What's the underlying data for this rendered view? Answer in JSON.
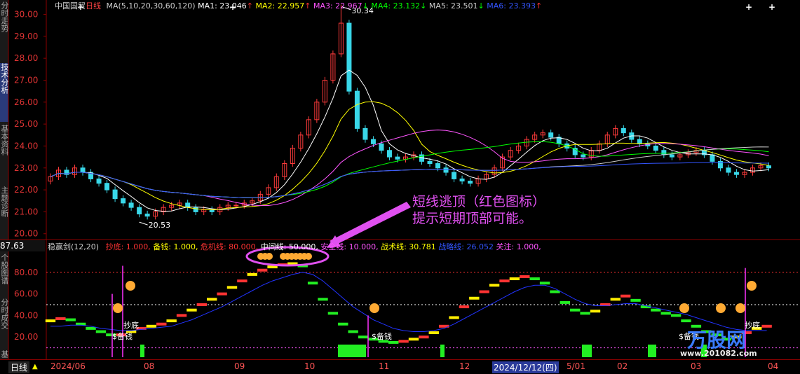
{
  "sidebar": {
    "tabs": [
      {
        "label": "分时走势",
        "active": false
      },
      {
        "label": "技术分析",
        "active": true
      },
      {
        "label": "基本资料",
        "active": false
      },
      {
        "label": "主题诊断",
        "active": false
      },
      {
        "label": "个股图谱",
        "active": false
      },
      {
        "label": "分时成交",
        "active": false
      },
      {
        "label": "基",
        "active": false
      }
    ]
  },
  "main_chart": {
    "stock_name": "中国国贸",
    "period": "日线",
    "ma_legend": "MA(5,10,20,30,60,120)",
    "ma_items": [
      {
        "label": "MA1: 23.046",
        "arrow": "↑",
        "color": "#ffffff"
      },
      {
        "label": "MA2: 22.957",
        "arrow": "↑",
        "color": "#ffff00"
      },
      {
        "label": "MA3: 22.967",
        "arrow": "↓",
        "color": "#ff55ff"
      },
      {
        "label": "MA4: 23.132",
        "arrow": "↓",
        "color": "#00ff00"
      },
      {
        "label": "MA5: 23.501",
        "arrow": "↓",
        "color": "#cccccc"
      },
      {
        "label": "MA6: 23.393",
        "arrow": "↑",
        "color": "#3355ff"
      }
    ],
    "y_ticks": [
      "30.00",
      "29.00",
      "28.00",
      "27.00",
      "26.00",
      "25.00",
      "24.00",
      "23.00",
      "22.00",
      "21.00",
      "20.00"
    ],
    "high_label": "30.34",
    "low_label": "20.53"
  },
  "indicator": {
    "current_value": "87.63",
    "name": "稳赢剑(12,20)",
    "items": [
      {
        "label": "抄底: 1.000,",
        "color": "#ff3333"
      },
      {
        "label": "备钱: 1.000,",
        "color": "#ffff00"
      },
      {
        "label": "危机线: 80.000,",
        "color": "#ff3333"
      },
      {
        "label": "中间线: 50.000,",
        "color": "#ffffff"
      },
      {
        "label": "安全线: 10.000,",
        "color": "#ff55ff"
      },
      {
        "label": "战术线: 30.781",
        "color": "#ffff00"
      },
      {
        "label": "战略线: 26.052",
        "color": "#3355ff"
      },
      {
        "label": "关注: 1.000,",
        "color": "#ff55ff"
      }
    ],
    "y_ticks": [
      "80.00",
      "60.00",
      "40.00",
      "20.00"
    ],
    "signal_labels": [
      "抄底",
      "$备钱",
      "$备钱",
      "$备钱",
      "抄底"
    ]
  },
  "annotation": {
    "line1": "短线逃顶（红色图标）",
    "line2": "提示短期顶部可能。"
  },
  "time_axis": {
    "period_button": "日线",
    "labels": [
      "2024/06",
      "08",
      "09",
      "10",
      "11",
      "12",
      "2024/12/12(四)",
      "5/01",
      "02",
      "03",
      "04"
    ]
  },
  "watermark": {
    "text": "万股网",
    "url": "www.201082.com"
  },
  "chart_data": [
    {
      "type": "candlestick",
      "title": "中国国贸 日线",
      "ylim": [
        19.8,
        30.4
      ],
      "high": 30.34,
      "low": 20.53,
      "closes": [
        22.6,
        22.9,
        22.7,
        23.0,
        22.8,
        22.5,
        22.3,
        22.0,
        21.6,
        21.4,
        21.2,
        20.9,
        20.8,
        21.0,
        21.2,
        21.3,
        21.4,
        21.2,
        21.0,
        21.1,
        21.0,
        21.2,
        21.3,
        21.3,
        21.4,
        21.5,
        21.8,
        22.1,
        22.6,
        23.2,
        23.9,
        24.5,
        25.2,
        26.0,
        27.0,
        28.2,
        29.6,
        26.5,
        24.8,
        24.3,
        24.1,
        23.8,
        23.5,
        23.4,
        23.5,
        23.6,
        23.3,
        23.2,
        23.0,
        22.8,
        22.5,
        22.4,
        22.3,
        22.5,
        22.7,
        23.0,
        23.5,
        23.8,
        24.0,
        24.3,
        24.5,
        24.6,
        24.4,
        24.1,
        23.9,
        23.6,
        23.5,
        23.8,
        24.1,
        24.5,
        24.8,
        24.6,
        24.3,
        24.1,
        24.0,
        23.8,
        23.6,
        23.5,
        23.6,
        23.7,
        23.8,
        23.6,
        23.3,
        23.0,
        22.8,
        22.7,
        22.8,
        23.0,
        23.1,
        23.0
      ]
    },
    {
      "type": "line",
      "title": "稳赢剑(12,20)",
      "ylim": [
        0,
        100
      ],
      "series": [
        {
          "name": "战术线",
          "values": [
            35,
            37,
            36,
            32,
            28,
            25,
            22,
            22,
            25,
            28,
            30,
            32,
            35,
            40,
            45,
            50,
            55,
            60,
            66,
            72,
            78,
            82,
            85,
            87,
            88,
            86,
            70,
            55,
            42,
            32,
            25,
            20,
            18,
            16,
            15,
            16,
            18,
            20,
            24,
            30,
            38,
            48,
            56,
            62,
            68,
            72,
            74,
            76,
            74,
            70,
            62,
            52,
            45,
            42,
            44,
            50,
            55,
            58,
            54,
            48,
            45,
            42,
            40,
            35,
            30,
            25,
            22,
            18,
            20,
            24,
            28,
            30
          ]
        },
        {
          "name": "战略线",
          "values": [
            30,
            30,
            31,
            31,
            30,
            28,
            27,
            26,
            26,
            27,
            28,
            29,
            30,
            33,
            36,
            40,
            44,
            48,
            53,
            58,
            63,
            68,
            72,
            75,
            78,
            80,
            78,
            72,
            64,
            56,
            48,
            42,
            36,
            32,
            28,
            26,
            25,
            25,
            26,
            28,
            32,
            37,
            42,
            47,
            52,
            57,
            62,
            66,
            68,
            68,
            65,
            60,
            55,
            51,
            49,
            49,
            50,
            51,
            51,
            49,
            47,
            45,
            43,
            41,
            38,
            35,
            32,
            29,
            27,
            26,
            26,
            26
          ]
        }
      ],
      "reference_lines": [
        80,
        50,
        10
      ]
    }
  ]
}
